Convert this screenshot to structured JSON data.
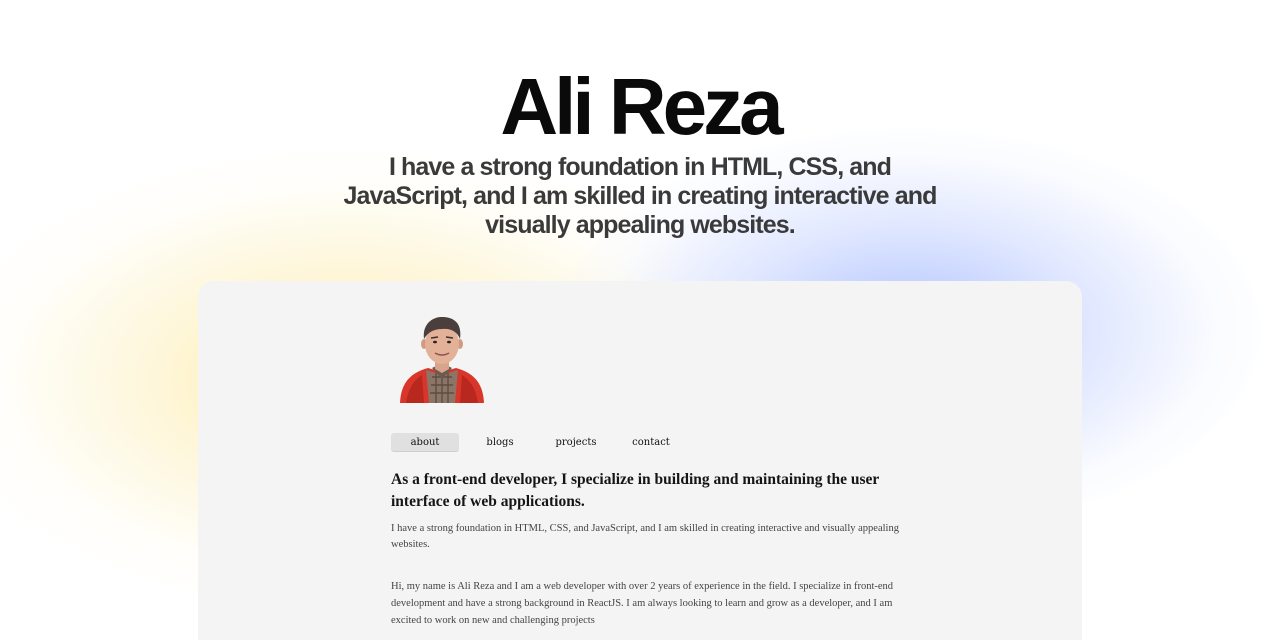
{
  "hero": {
    "name": "Ali Reza",
    "tagline": "I have a strong foundation in HTML, CSS, and JavaScript, and I am skilled in creating interactive and visually appealing websites."
  },
  "preview": {
    "avatar_icon": "person-portrait-icon",
    "nav": [
      {
        "label": "about",
        "active": true
      },
      {
        "label": "blogs",
        "active": false
      },
      {
        "label": "projects",
        "active": false
      },
      {
        "label": "contact",
        "active": false
      }
    ],
    "lead": "As a front-end developer, I specialize in building and maintaining the user interface of web applications.",
    "sub": "I have a strong foundation in HTML, CSS, and JavaScript, and I am skilled in creating interactive and visually appealing websites.",
    "bio": "Hi, my name is Ali Reza and I am a web developer with over 2 years of experience in the field. I specialize in front-end development and have a strong background in ReactJS. I am always looking to learn and grow as a developer, and I am excited to work on new and challenging projects"
  },
  "colors": {
    "background": "#ffffff",
    "card": "#f4f4f4",
    "glow_yellow": "#fce896",
    "glow_blue": "#96afff",
    "active_tab": "#e0e0e0"
  }
}
